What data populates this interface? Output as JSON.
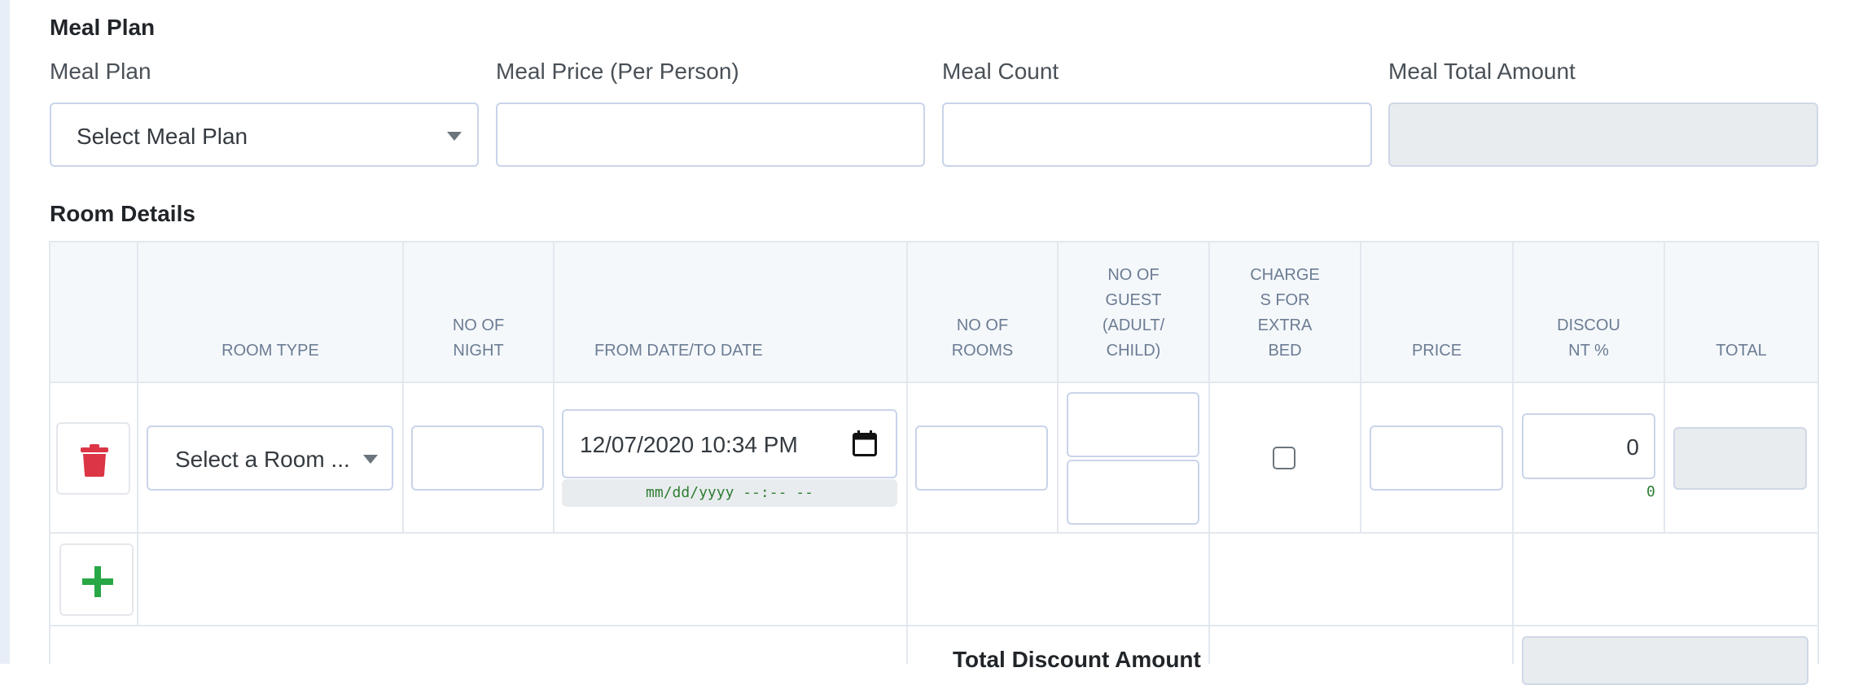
{
  "meal_plan": {
    "section_title": "Meal Plan",
    "plan_label": "Meal Plan",
    "plan_select_value": "Select Meal Plan",
    "price_label": "Meal Price (Per Person)",
    "count_label": "Meal Count",
    "total_label": "Meal Total Amount"
  },
  "room_details": {
    "section_title": "Room Details",
    "columns": {
      "room_type": "ROOM TYPE",
      "nights_1": "NO OF",
      "nights_2": "NIGHT",
      "dates": "FROM DATE/TO DATE",
      "rooms_1": "NO OF",
      "rooms_2": "ROOMS",
      "guest_1": "NO OF",
      "guest_2": "GUEST",
      "guest_3": "(ADULT/",
      "guest_4": "CHILD)",
      "extra_1": "CHARGE",
      "extra_2": "S FOR",
      "extra_3": "EXTRA",
      "extra_4": "BED",
      "price": "PRICE",
      "discount_1": "DISCOU",
      "discount_2": "NT %",
      "total": "TOTAL"
    },
    "row": {
      "room_type_value": "Select a Room ...",
      "datetime_value": "12/07/2020 10:34 PM",
      "datetime_hint": "mm/dd/yyyy --:-- --",
      "discount_value": "0",
      "discount_hint": "0"
    },
    "total_discount_label": "Total Discount Amount"
  },
  "colors": {
    "delete": "#dc3545",
    "add": "#28a745",
    "hint": "#2e7d32",
    "header_bg": "#f5f8fb"
  }
}
